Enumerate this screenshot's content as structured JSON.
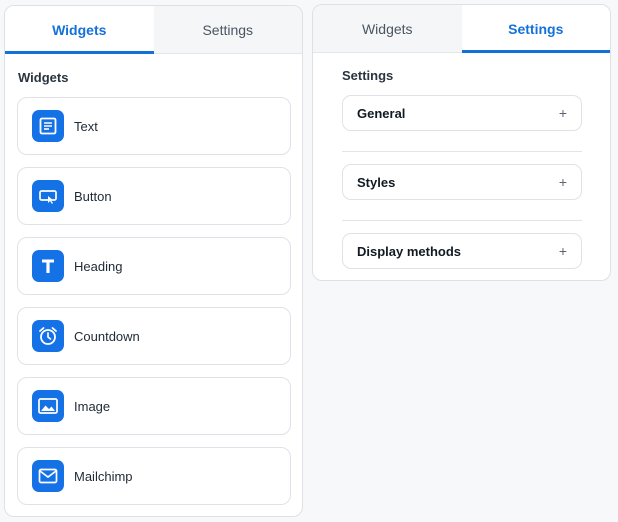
{
  "left_panel": {
    "tabs": [
      {
        "label": "Widgets"
      },
      {
        "label": "Settings"
      }
    ],
    "section_title": "Widgets",
    "widgets": [
      {
        "label": "Text",
        "icon": "text-icon"
      },
      {
        "label": "Button",
        "icon": "button-icon"
      },
      {
        "label": "Heading",
        "icon": "heading-icon"
      },
      {
        "label": "Countdown",
        "icon": "alarm-clock-icon"
      },
      {
        "label": "Image",
        "icon": "image-icon"
      },
      {
        "label": "Mailchimp",
        "icon": "mail-icon"
      }
    ]
  },
  "right_panel": {
    "tabs": [
      {
        "label": "Widgets"
      },
      {
        "label": "Settings"
      }
    ],
    "section_title": "Settings",
    "accordion": [
      {
        "label": "General",
        "toggle": "+"
      },
      {
        "label": "Styles",
        "toggle": "+"
      },
      {
        "label": "Display methods",
        "toggle": "+"
      }
    ]
  },
  "colors": {
    "accent": "#1471d9",
    "icon_bg": "#1471e6"
  }
}
